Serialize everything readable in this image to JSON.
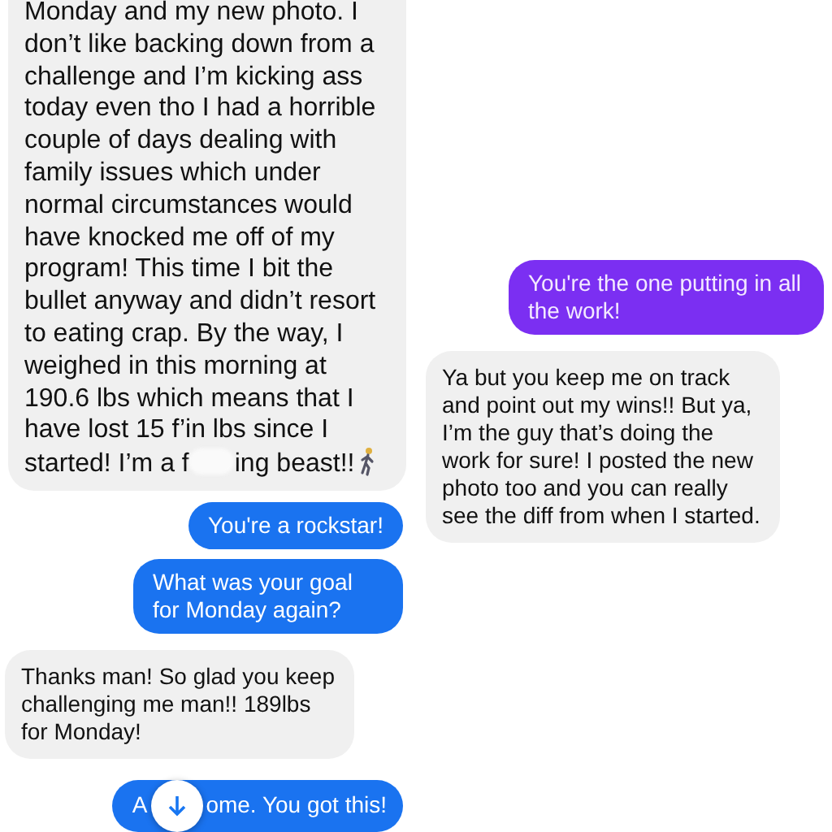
{
  "left_chat": {
    "messages": [
      {
        "kind": "received",
        "text": "Monday and my new photo. I don’t like backing down from a challenge and I’m kicking ass today even tho I had a horrible couple of days dealing with family issues which under normal circumstances would have knocked me off of my program! This time I bit the bullet anyway and didn’t resort to eating crap. By the way, I weighed in this morning at 190.6 lbs which means that I have lost 15 f’in lbs since I started! I’m a f",
        "text_after_redaction": "ing beast!!"
      },
      {
        "kind": "sent",
        "text": "You're a rockstar!"
      },
      {
        "kind": "sent",
        "text": "What was your goal for Monday again?"
      },
      {
        "kind": "received",
        "text": "Thanks man! So glad you keep challenging me man!! 189lbs for Monday!"
      },
      {
        "kind": "sent_covered",
        "text": "A",
        "text_after_button": "ome. You got this!"
      }
    ]
  },
  "right_chat": {
    "messages": [
      {
        "kind": "sent",
        "text": "You're the one putting in all the work!"
      },
      {
        "kind": "received",
        "text": "Ya but you keep me on track and point out my wins!! But ya, I’m the guy that’s doing the work for sure! I posted the new photo too and you can really see the diff from when I started."
      }
    ]
  }
}
